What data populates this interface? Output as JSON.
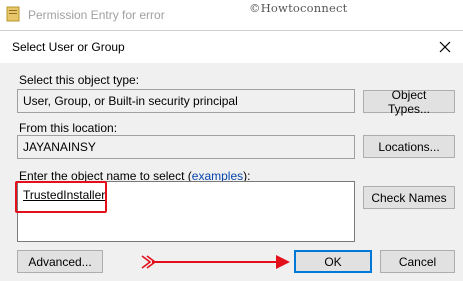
{
  "background_window": {
    "title": "Permission Entry for error",
    "icon": "folder-icon"
  },
  "watermark": "©Howtoconnect",
  "dialog": {
    "title": "Select User or Group",
    "close_icon": "close-icon",
    "object_type_label": "Select this object type:",
    "object_type_value": "User, Group, or Built-in security principal",
    "object_types_button": "Object Types...",
    "location_label": "From this location:",
    "location_value": "JAYANAINSY",
    "locations_button": "Locations...",
    "enter_label_prefix": "Enter the object name to select (",
    "examples_link": "examples",
    "enter_label_suffix": "):",
    "object_name_value": "TrustedInstaller",
    "check_names_button": "Check Names",
    "advanced_button": "Advanced...",
    "ok_button": "OK",
    "cancel_button": "Cancel"
  },
  "colors": {
    "annotation_red": "#e3101c",
    "focus_blue": "#0078d7",
    "link_blue": "#0645ad"
  }
}
